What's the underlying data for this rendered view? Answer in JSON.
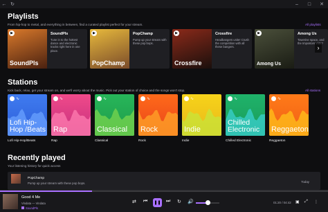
{
  "titlebar": {
    "back_icon": "back-arrow",
    "refresh_icon": "refresh"
  },
  "playlists": {
    "title": "Playlists",
    "subtitle": "From hip-hop to metal, and everything in between, find a curated playlist perfect for your stream.",
    "all_link": "All playlists",
    "items": [
      {
        "name": "SoundPls",
        "desc": "Tune in to the hottest dance and electronic tracks right here in one place.",
        "overlay": "SoundPls",
        "c1": "#d9792b",
        "c2": "#4a2110"
      },
      {
        "name": "PopChamp",
        "desc": "Pump up your stream with these pop bops.",
        "overlay": "PopChamp",
        "c1": "#e7b93c",
        "c2": "#7a4b2a"
      },
      {
        "name": "Crossfire",
        "desc": "Headbangers unite! Crush the competition with all these bangers.",
        "overlay": "Crossfire",
        "c1": "#8b2a1a",
        "c2": "#1a0f0c"
      },
      {
        "name": "Among Us",
        "desc": "Towerine space, and the Impostors vote?",
        "overlay": "Among Us",
        "c1": "#4a4f3a",
        "c2": "#1a1c14"
      }
    ]
  },
  "stations": {
    "title": "Stations",
    "subtitle": "Kick back, relax, get your stream on, and we'll worry about the music. Pick out your station of choice and the songs won't stop.",
    "all_link": "All stations",
    "items": [
      {
        "label": "Lofi Hip-Hop/Beats",
        "card": "Lofi Hip-Hop /Beats",
        "top": "#3f7bf0",
        "bottom": "#2e5fd8",
        "wave": "#6aa2ff"
      },
      {
        "label": "Rap",
        "card": "Rap",
        "top": "#f04a8a",
        "bottom": "#c5307e",
        "wave": "#ff7eb0"
      },
      {
        "label": "Classical",
        "card": "Classical",
        "top": "#27b65a",
        "bottom": "#1f9a49",
        "wave": "#7ad64e"
      },
      {
        "label": "Rock",
        "card": "Rock",
        "top": "#ff6a1a",
        "bottom": "#e8441a",
        "wave": "#ffa528"
      },
      {
        "label": "Indie",
        "card": "Indie",
        "top": "#f7d31a",
        "bottom": "#e8b81a",
        "wave": "#c7e63a"
      },
      {
        "label": "Chilled Electronic",
        "card": "Chilled Electronic",
        "top": "#1fb36a",
        "bottom": "#1a9a5a",
        "wave": "#3ad0d0"
      },
      {
        "label": "Reggaeton",
        "card": "Reggaeton",
        "top": "#ff7a18",
        "bottom": "#f06016",
        "wave": "#ffc21a"
      }
    ]
  },
  "recently_played": {
    "title": "Recently played",
    "subtitle": "Your listening history for quick access",
    "items": [
      {
        "title": "PopChamp",
        "desc": "Pump up your stream with these pop bops.",
        "time": "Today"
      }
    ]
  },
  "player": {
    "title": "Good 4 Me",
    "artist": "Vindata — Vindata",
    "source": "SoundPls",
    "time": "01:20 / 04:42",
    "progress": 0.28,
    "volume": 0.5,
    "accent": "#a970ff"
  }
}
